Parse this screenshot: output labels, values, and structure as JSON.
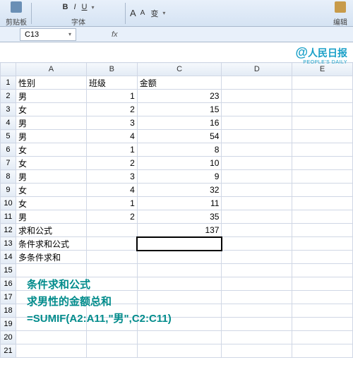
{
  "ribbon": {
    "group1": "剪贴板",
    "group2": "字体",
    "group3_icons": [
      "A",
      "A",
      "变"
    ],
    "group4": "编辑"
  },
  "namebox": {
    "cell": "C13"
  },
  "fx": "fx",
  "watermark": {
    "at": "@",
    "main": "人民日报",
    "sub": "PEOPLE'S DAILY"
  },
  "cols": [
    "",
    "A",
    "B",
    "C",
    "D",
    "E"
  ],
  "rows": [
    {
      "n": "1",
      "a": "性别",
      "b": "班级",
      "c": "金额",
      "d": "",
      "ba": "left",
      "ca": "left"
    },
    {
      "n": "2",
      "a": "男",
      "b": "1",
      "c": "23",
      "d": ""
    },
    {
      "n": "3",
      "a": "女",
      "b": "2",
      "c": "15",
      "d": ""
    },
    {
      "n": "4",
      "a": "男",
      "b": "3",
      "c": "16",
      "d": ""
    },
    {
      "n": "5",
      "a": "男",
      "b": "4",
      "c": "54",
      "d": ""
    },
    {
      "n": "6",
      "a": "女",
      "b": "1",
      "c": "8",
      "d": ""
    },
    {
      "n": "7",
      "a": "女",
      "b": "2",
      "c": "10",
      "d": ""
    },
    {
      "n": "8",
      "a": "男",
      "b": "3",
      "c": "9",
      "d": ""
    },
    {
      "n": "9",
      "a": "女",
      "b": "4",
      "c": "32",
      "d": ""
    },
    {
      "n": "10",
      "a": "女",
      "b": "1",
      "c": "11",
      "d": ""
    },
    {
      "n": "11",
      "a": "男",
      "b": "2",
      "c": "35",
      "d": ""
    },
    {
      "n": "12",
      "a": "求和公式",
      "b": "",
      "c": "137",
      "d": ""
    },
    {
      "n": "13",
      "a": "条件求和公式",
      "b": "",
      "c": "",
      "d": "",
      "active": true
    },
    {
      "n": "14",
      "a": "多条件求和",
      "b": "",
      "c": "",
      "d": ""
    },
    {
      "n": "15",
      "a": "",
      "b": "",
      "c": "",
      "d": ""
    },
    {
      "n": "16",
      "a": "",
      "b": "",
      "c": "",
      "d": ""
    },
    {
      "n": "17",
      "a": "",
      "b": "",
      "c": "",
      "d": ""
    },
    {
      "n": "18",
      "a": "",
      "b": "",
      "c": "",
      "d": ""
    },
    {
      "n": "19",
      "a": "",
      "b": "",
      "c": "",
      "d": ""
    },
    {
      "n": "20",
      "a": "",
      "b": "",
      "c": "",
      "d": ""
    },
    {
      "n": "21",
      "a": "",
      "b": "",
      "c": "",
      "d": ""
    }
  ],
  "annotation": {
    "line1": "条件求和公式",
    "line2": "求男性的金额总和",
    "line3": "=SUMIF(A2:A11,\"男\",C2:C11)"
  }
}
